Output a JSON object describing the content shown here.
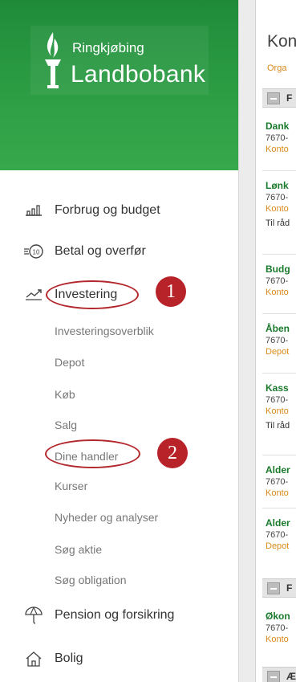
{
  "colors": {
    "brand_green": "#2e9f45",
    "highlight_red": "#b3282d",
    "account_green": "#1a7a2c",
    "link_orange": "#d98a1c"
  },
  "logo": {
    "line1": "Ringkjøbing",
    "line2": "Landbobank",
    "icon": "flame-torch-icon"
  },
  "nav": {
    "forbrug": {
      "label": "Forbrug og budget",
      "icon": "bar-chart-icon"
    },
    "betal": {
      "label": "Betal og overfør",
      "icon": "transfer-coin-icon"
    },
    "investering": {
      "label": "Investering",
      "icon": "trend-line-icon"
    },
    "sub": [
      "Investeringsoverblik",
      "Depot",
      "Køb",
      "Salg",
      "Dine handler",
      "Kurser",
      "Nyheder og analyser",
      "Søg aktie",
      "Søg obligation"
    ],
    "pension": {
      "label": "Pension og forsikring",
      "icon": "umbrella-icon"
    },
    "bolig": {
      "label": "Bolig",
      "icon": "house-icon"
    }
  },
  "badges": {
    "one": "1",
    "two": "2"
  },
  "panel": {
    "title": "Kon",
    "org": "Orga",
    "groups": [
      "F",
      "F",
      "Æ"
    ],
    "accounts": [
      {
        "name": "Dank",
        "number": "7670-",
        "type": "Konto",
        "extra": ""
      },
      {
        "name": "Lønk",
        "number": "7670-",
        "type": "Konto",
        "extra": "Til råd"
      },
      {
        "name": "Budg",
        "number": "7670-",
        "type": "Konto",
        "extra": ""
      },
      {
        "name": "Åben",
        "number": "7670-",
        "type": "Depot",
        "extra": ""
      },
      {
        "name": "Kass",
        "number": "7670-",
        "type": "Konto",
        "extra": "Til råd"
      },
      {
        "name": "Alder",
        "number": "7670-",
        "type": "Konto",
        "extra": ""
      },
      {
        "name": "Alder",
        "number": "7670-",
        "type": "Depot",
        "extra": ""
      },
      {
        "name": "Økon",
        "number": "7670-",
        "type": "Konto",
        "extra": ""
      }
    ]
  }
}
